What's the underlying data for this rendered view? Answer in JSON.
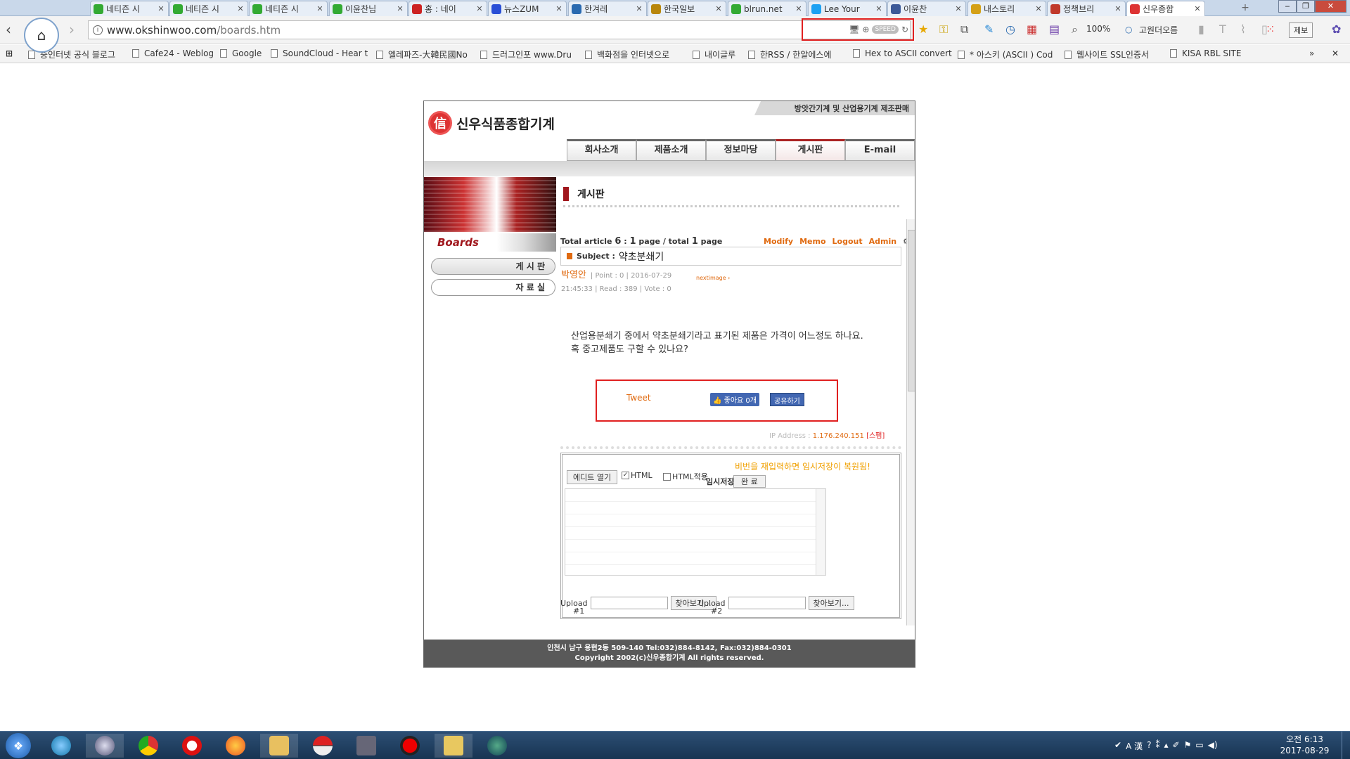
{
  "browser": {
    "tabs": [
      {
        "title": "네티즌 시",
        "icon": "sprout-icon",
        "color": "#3a3"
      },
      {
        "title": "네티즌 시",
        "icon": "sprout-icon",
        "color": "#3a3"
      },
      {
        "title": "네티즌 시",
        "icon": "sprout-icon",
        "color": "#3a3"
      },
      {
        "title": "이윤찬님",
        "icon": "sprout-icon",
        "color": "#3a3"
      },
      {
        "title": "홍 : 네이",
        "icon": "red-dot-icon",
        "color": "#c22"
      },
      {
        "title": "뉴스ZUM",
        "icon": "zum-icon",
        "color": "#2a4fd6"
      },
      {
        "title": "한겨레",
        "icon": "hani-icon",
        "color": "#2a6ab0"
      },
      {
        "title": "한국일보",
        "icon": "hankook-icon",
        "color": "#b8860b"
      },
      {
        "title": "blrun.net",
        "icon": "sprout-icon",
        "color": "#3a3"
      },
      {
        "title": "Lee Your",
        "icon": "twitter-icon",
        "color": "#1da1f2"
      },
      {
        "title": "이윤찬",
        "icon": "facebook-icon",
        "color": "#3b5998"
      },
      {
        "title": "내스토리",
        "icon": "story-icon",
        "color": "#d4a017"
      },
      {
        "title": "정책브리",
        "icon": "policy-icon",
        "color": "#c0392b"
      },
      {
        "title": "신우종합",
        "icon": "site-icon",
        "color": "#d33"
      }
    ],
    "url": {
      "domain": "www.okshinwoo.com",
      "path": "/boards.htm"
    },
    "speed_label": "SPEED",
    "zoom": "100%",
    "gowon": "고원더오름",
    "jebo": "제보",
    "bookmarks": [
      "중인터넷 공식 블로그",
      "Cafe24 - Weblog",
      "Google",
      "SoundCloud - Hear t",
      "엘레파즈-大韓民國No",
      "드러그인포 www.Dru",
      "백화점을 인터넷으로",
      "내이글루",
      "한RSS / 한알에스에",
      "Hex to ASCII convert",
      "* 아스키 (ASCII ) Cod",
      "웹사이트 SSL인증서",
      "KISA RBL SITE"
    ]
  },
  "site": {
    "logo_text": "신우식품종합기계",
    "logo_mark": "信",
    "slogan": "방앗간기계 및 산업용기계 제조판매",
    "nav": [
      "회사소개",
      "제품소개",
      "정보마당",
      "게시판",
      "E-mail"
    ],
    "sidebar": {
      "title": "Boards",
      "items": [
        "게 시 판",
        "자 료 실"
      ]
    },
    "board": {
      "page_title": "게시판",
      "total_label": "Total article",
      "total_count": "6",
      "page_info_1": "1",
      "page_info_mid": "page / total",
      "page_info_2": "1",
      "page_info_end": "page",
      "admin_links": [
        "Modify",
        "Memo",
        "Logout",
        "Admin"
      ],
      "subject_label": "Subject :",
      "subject": "약초분쇄기",
      "author": "박영안",
      "point": "Point : 0",
      "date": "2016-07-29",
      "time": "21:45:33",
      "read": "Read : 389",
      "vote": "Vote : 0",
      "nextimage": "nextimage",
      "body_line1": "산업용분쇄기 중에서 약초분쇄기라고 표기된 제품은 가격이 어느정도 하나요.",
      "body_line2": "혹 중고제품도 구할 수 있나요?",
      "tweet": "Tweet",
      "like": "좋아요 0개",
      "share": "공유하기",
      "ip_label": "IP Address :",
      "ip": "1.176.240.151",
      "spam": "[스팸]"
    },
    "comment": {
      "edit_button": "에디트 열기",
      "html_label": "HTML",
      "html_apply_label": "HTML적용",
      "warning": "비번을 재입력하면 임시저장이 복원됨!",
      "temp_save": "임시저장",
      "done_button": "완 료",
      "upload_label": "Upload",
      "browse_button": "찾아보기...",
      "upload1_no": "#1",
      "upload2_no": "#2"
    },
    "footer_line1": "인천시 남구 용현2동 509-140 Tel:032)884-8142, Fax:032)884-0301",
    "footer_line2": "Copyright 2002(c)신우종합기계  All rights reserved."
  },
  "taskbar": {
    "clock_time": "오전 6:13",
    "clock_date": "2017-08-29",
    "ime": "A 漢"
  }
}
